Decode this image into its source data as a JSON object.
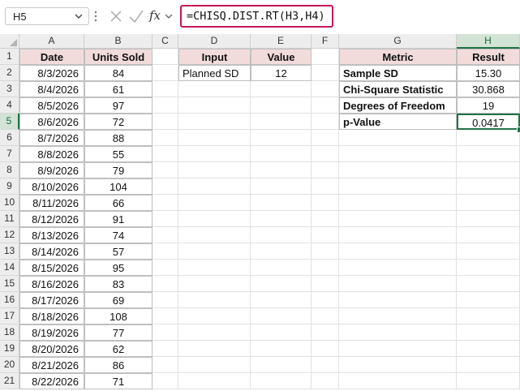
{
  "formula_bar": {
    "name_box": "H5",
    "formula": "=CHISQ.DIST.RT(H3,H4)",
    "fx_label": "fx"
  },
  "columns": [
    "A",
    "B",
    "C",
    "D",
    "E",
    "F",
    "G",
    "H"
  ],
  "rows": [
    "1",
    "2",
    "3",
    "4",
    "5",
    "6",
    "7",
    "8",
    "9",
    "10",
    "11",
    "12",
    "13",
    "14",
    "15",
    "16",
    "17",
    "18",
    "19",
    "20",
    "21"
  ],
  "table1": {
    "headers": [
      "Date",
      "Units Sold"
    ],
    "rows": [
      [
        "8/3/2026",
        "84"
      ],
      [
        "8/4/2026",
        "61"
      ],
      [
        "8/5/2026",
        "97"
      ],
      [
        "8/6/2026",
        "72"
      ],
      [
        "8/7/2026",
        "88"
      ],
      [
        "8/8/2026",
        "55"
      ],
      [
        "8/9/2026",
        "79"
      ],
      [
        "8/10/2026",
        "104"
      ],
      [
        "8/11/2026",
        "66"
      ],
      [
        "8/12/2026",
        "91"
      ],
      [
        "8/13/2026",
        "74"
      ],
      [
        "8/14/2026",
        "57"
      ],
      [
        "8/15/2026",
        "95"
      ],
      [
        "8/16/2026",
        "83"
      ],
      [
        "8/17/2026",
        "69"
      ],
      [
        "8/18/2026",
        "108"
      ],
      [
        "8/19/2026",
        "77"
      ],
      [
        "8/20/2026",
        "62"
      ],
      [
        "8/21/2026",
        "86"
      ],
      [
        "8/22/2026",
        "71"
      ]
    ]
  },
  "input_table": {
    "headers": [
      "Input",
      "Value"
    ],
    "rows": [
      [
        "Planned SD",
        "12"
      ]
    ]
  },
  "metric_table": {
    "headers": [
      "Metric",
      "Result"
    ],
    "rows": [
      [
        "Sample SD",
        "15.30"
      ],
      [
        "Chi-Square Statistic",
        "30.868"
      ],
      [
        "Degrees of Freedom",
        "19"
      ],
      [
        "p-Value",
        "0.0417"
      ]
    ]
  },
  "active_cell": "H5",
  "colors": {
    "header_fill": "#f2dcdb",
    "selection": "#217346",
    "formula_highlight": "#c2185b"
  }
}
